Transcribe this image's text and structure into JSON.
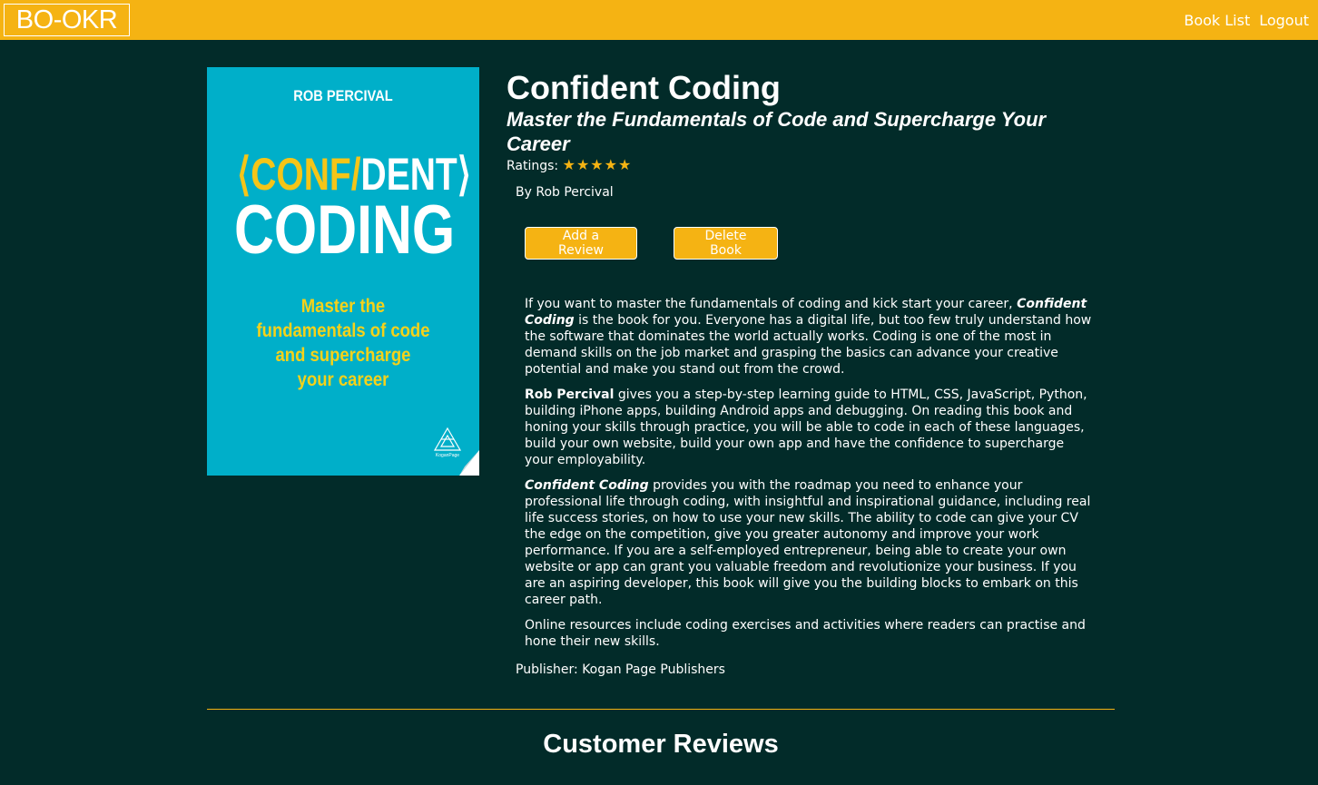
{
  "nav": {
    "logo": "BO-OKR",
    "links": [
      "Book List",
      "Logout"
    ]
  },
  "colors": {
    "nav_bg": "#f5b313",
    "page_bg": "#022b29",
    "accent": "#f5b313",
    "cover_bg": "#00afc9"
  },
  "cover": {
    "author": "ROB PERCIVAL",
    "title_line1_open": "⟨CONF",
    "title_line1_slash": "/",
    "title_line1_close": "DENT⟩",
    "title_line2": "CODING",
    "subtitle_lines": "Master the fundamentals of code and supercharge your career",
    "publisher_logo_text": "KoganPage"
  },
  "book": {
    "title": "Confident Coding",
    "subtitle": "Master the Fundamentals of Code and Supercharge Your Career",
    "ratings_label": "Ratings:",
    "stars": "★★★★★",
    "rating_value": 5,
    "byline": "By Rob Percival",
    "publisher": "Publisher: Kogan Page Publishers"
  },
  "actions": {
    "add_review": "Add a Review",
    "delete_book": "Delete Book"
  },
  "description": {
    "p1_before": "If you want to master the fundamentals of coding and kick start your career, ",
    "p1_bold": "Confident Coding",
    "p1_after": " is the book for you. Everyone has a digital life, but too few truly understand how the software that dominates the world actually works. Coding is one of the most in demand skills on the job market and grasping the basics can advance your creative potential and make you stand out from the crowd.",
    "p2_bold": "Rob Percival",
    "p2_after": " gives you a step-by-step learning guide to HTML, CSS, JavaScript, Python, building iPhone apps, building Android apps and debugging. On reading this book and honing your skills through practice, you will be able to code in each of these languages, build your own website, build your own app and have the confidence to supercharge your employability.",
    "p3_bold": "Confident Coding",
    "p3_after": " provides you with the roadmap you need to enhance your professional life through coding, with insightful and inspirational guidance, including real life success stories, on how to use your new skills. The ability to code can give your CV the edge on the competition, give you greater autonomy and improve your work performance. If you are a self-employed entrepreneur, being able to create your own website or app can grant you valuable freedom and revolutionize your business. If you are an aspiring developer, this book will give you the building blocks to embark on this career path.",
    "p4": "Online resources include coding exercises and activities where readers can practise and hone their new skills."
  },
  "reviews": {
    "heading": "Customer Reviews"
  }
}
